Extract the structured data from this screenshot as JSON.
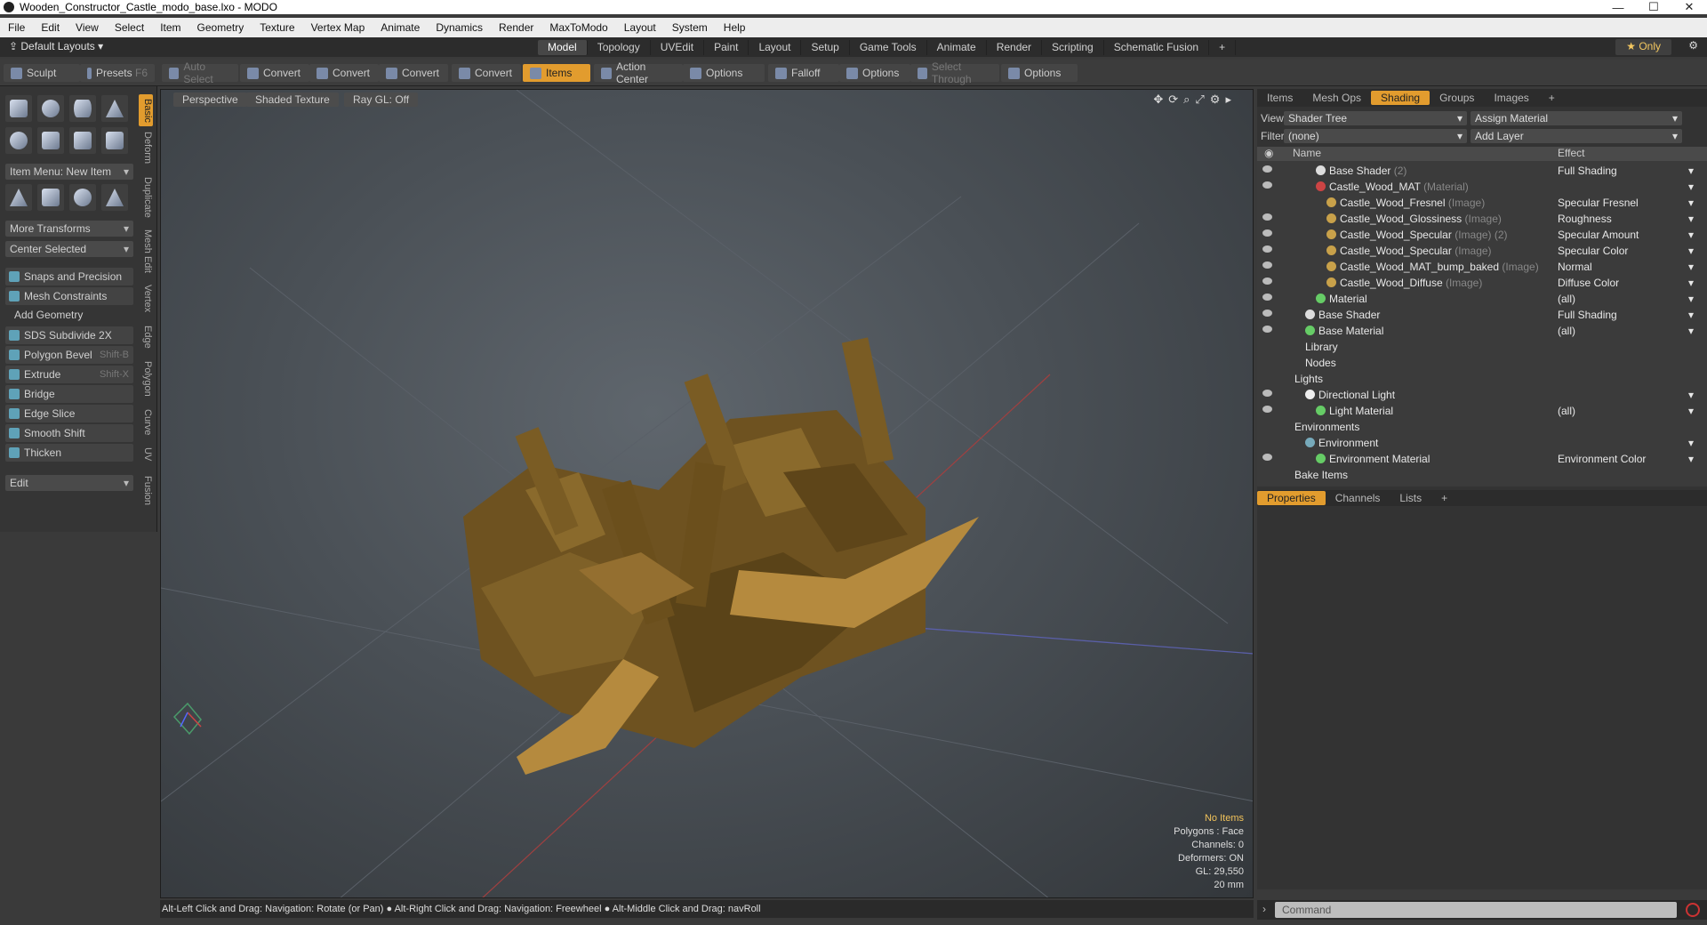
{
  "window": {
    "title": "Wooden_Constructor_Castle_modo_base.lxo - MODO"
  },
  "menu": [
    "File",
    "Edit",
    "View",
    "Select",
    "Item",
    "Geometry",
    "Texture",
    "Vertex Map",
    "Animate",
    "Dynamics",
    "Render",
    "MaxToModo",
    "Layout",
    "System",
    "Help"
  ],
  "layout": {
    "default_layouts": "Default Layouts",
    "tabs": [
      "Model",
      "Topology",
      "UVEdit",
      "Paint",
      "Layout",
      "Setup",
      "Game Tools",
      "Animate",
      "Render",
      "Scripting",
      "Schematic Fusion"
    ],
    "active_tab": "Model",
    "only": "Only"
  },
  "toolbar": {
    "sculpt": "Sculpt",
    "presets": "Presets",
    "presets_key": "F6",
    "auto_select": "Auto Select",
    "convert": "Convert",
    "items": "Items",
    "action_center": "Action Center",
    "options": "Options",
    "falloff": "Falloff",
    "select_through": "Select Through"
  },
  "left": {
    "vtabs": [
      "Basic",
      "Deform",
      "Duplicate",
      "Mesh Edit",
      "Vertex",
      "Edge",
      "Polygon",
      "Curve",
      "UV",
      "Fusion"
    ],
    "item_menu": "Item Menu: New Item",
    "more_transforms": "More Transforms",
    "center_selected": "Center Selected",
    "snaps": "Snaps and Precision",
    "mesh_constraints": "Mesh Constraints",
    "add_geometry": "Add Geometry",
    "tools": [
      {
        "label": "SDS Subdivide 2X",
        "key": ""
      },
      {
        "label": "Polygon Bevel",
        "key": "Shift-B"
      },
      {
        "label": "Extrude",
        "key": "Shift-X"
      },
      {
        "label": "Bridge",
        "key": ""
      },
      {
        "label": "Edge Slice",
        "key": ""
      },
      {
        "label": "Smooth Shift",
        "key": ""
      },
      {
        "label": "Thicken",
        "key": ""
      }
    ],
    "edit": "Edit"
  },
  "viewport": {
    "perspective": "Perspective",
    "shaded_texture": "Shaded Texture",
    "raygl": "Ray GL: Off",
    "stats": {
      "no_items": "No Items",
      "polygons": "Polygons : Face",
      "channels": "Channels: 0",
      "deformers": "Deformers: ON",
      "gl": "GL: 29,550",
      "scale": "20 mm"
    }
  },
  "statusbar": "Alt-Left Click and Drag: Navigation: Rotate (or Pan) ● Alt-Right Click and Drag: Navigation: Freewheel ● Alt-Middle Click and Drag: navRoll",
  "right": {
    "tabs": [
      "Items",
      "Mesh Ops",
      "Shading",
      "Groups",
      "Images"
    ],
    "active_tab": "Shading",
    "view_label": "View",
    "view_value": "Shader Tree",
    "assign_material": "Assign Material",
    "filter_label": "Filter",
    "filter_value": "(none)",
    "add_layer": "Add Layer",
    "col_name": "Name",
    "col_effect": "Effect",
    "tree": [
      {
        "name": "Base Shader",
        "type": "(2)",
        "effect": "Full Shading",
        "indent": 3,
        "dot": "#ddd",
        "eye": true
      },
      {
        "name": "Castle_Wood_MAT",
        "type": "(Material)",
        "effect": "",
        "indent": 3,
        "dot": "#c44",
        "eye": true
      },
      {
        "name": "Castle_Wood_Fresnel",
        "type": "(Image)",
        "effect": "Specular Fresnel",
        "indent": 4,
        "dot": "#c8a14a",
        "eye": false
      },
      {
        "name": "Castle_Wood_Glossiness",
        "type": "(Image)",
        "effect": "Roughness",
        "indent": 4,
        "dot": "#c8a14a",
        "eye": true
      },
      {
        "name": "Castle_Wood_Specular",
        "type": "(Image) (2)",
        "effect": "Specular Amount",
        "indent": 4,
        "dot": "#c8a14a",
        "eye": true
      },
      {
        "name": "Castle_Wood_Specular",
        "type": "(Image)",
        "effect": "Specular Color",
        "indent": 4,
        "dot": "#c8a14a",
        "eye": true
      },
      {
        "name": "Castle_Wood_MAT_bump_baked",
        "type": "(Image)",
        "effect": "Normal",
        "indent": 4,
        "dot": "#c8a14a",
        "eye": true
      },
      {
        "name": "Castle_Wood_Diffuse",
        "type": "(Image)",
        "effect": "Diffuse Color",
        "indent": 4,
        "dot": "#c8a14a",
        "eye": true
      },
      {
        "name": "Material",
        "type": "",
        "effect": "(all)",
        "indent": 3,
        "dot": "#6c6",
        "eye": true
      },
      {
        "name": "Base Shader",
        "type": "",
        "effect": "Full Shading",
        "indent": 2,
        "dot": "#ddd",
        "eye": true
      },
      {
        "name": "Base Material",
        "type": "",
        "effect": "(all)",
        "indent": 2,
        "dot": "#6c6",
        "eye": true
      },
      {
        "name": "Library",
        "type": "",
        "effect": "",
        "indent": 2,
        "dot": "",
        "eye": false
      },
      {
        "name": "Nodes",
        "type": "",
        "effect": "",
        "indent": 2,
        "dot": "",
        "eye": false
      },
      {
        "name": "Lights",
        "type": "",
        "effect": "",
        "indent": 1,
        "dot": "",
        "eye": false
      },
      {
        "name": "Directional Light",
        "type": "",
        "effect": "",
        "indent": 2,
        "dot": "#eee",
        "eye": true
      },
      {
        "name": "Light Material",
        "type": "",
        "effect": "(all)",
        "indent": 3,
        "dot": "#6c6",
        "eye": true
      },
      {
        "name": "Environments",
        "type": "",
        "effect": "",
        "indent": 1,
        "dot": "",
        "eye": false
      },
      {
        "name": "Environment",
        "type": "",
        "effect": "",
        "indent": 2,
        "dot": "#7ab",
        "eye": false
      },
      {
        "name": "Environment Material",
        "type": "",
        "effect": "Environment Color",
        "indent": 3,
        "dot": "#6c6",
        "eye": true
      },
      {
        "name": "Bake Items",
        "type": "",
        "effect": "",
        "indent": 1,
        "dot": "",
        "eye": false
      }
    ],
    "prop_tabs": [
      "Properties",
      "Channels",
      "Lists"
    ],
    "command_placeholder": "Command"
  }
}
